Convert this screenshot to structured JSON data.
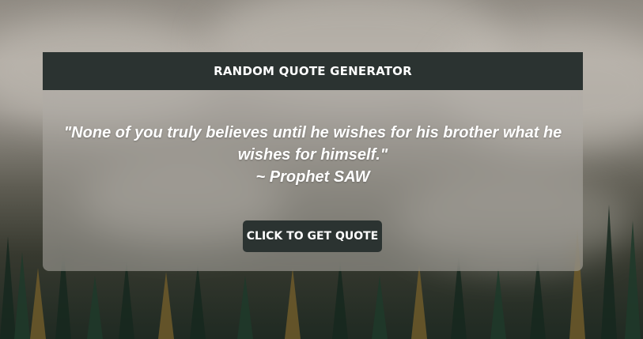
{
  "app": {
    "header_title": "RANDOM QUOTE GENERATOR"
  },
  "quote": {
    "text": "\"None of you truly believes until he wishes for his brother what he wishes for himself.\"",
    "author": "~ Prophet SAW"
  },
  "actions": {
    "get_quote_label": "CLICK TO GET QUOTE"
  },
  "colors": {
    "header_bg": "#2b3331",
    "button_bg": "#2b3331",
    "text": "#ffffff"
  }
}
